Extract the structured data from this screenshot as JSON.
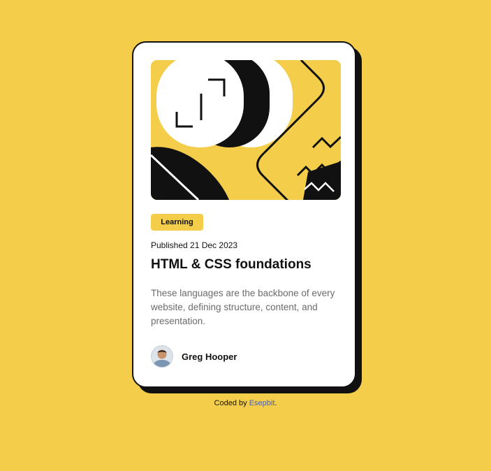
{
  "card": {
    "tag": "Learning",
    "published": "Published 21 Dec 2023",
    "title": "HTML & CSS foundations",
    "description": "These languages are the backbone of every website, defining structure, content, and presentation.",
    "author": {
      "name": "Greg Hooper"
    }
  },
  "footer": {
    "prefix": "Coded by ",
    "link_text": "Esepbit",
    "suffix": "."
  },
  "colors": {
    "background": "#F4CE4A",
    "card": "#FFFFFF",
    "ink": "#111111",
    "muted_text": "#6B6B6B",
    "link": "#4B5EAA"
  }
}
